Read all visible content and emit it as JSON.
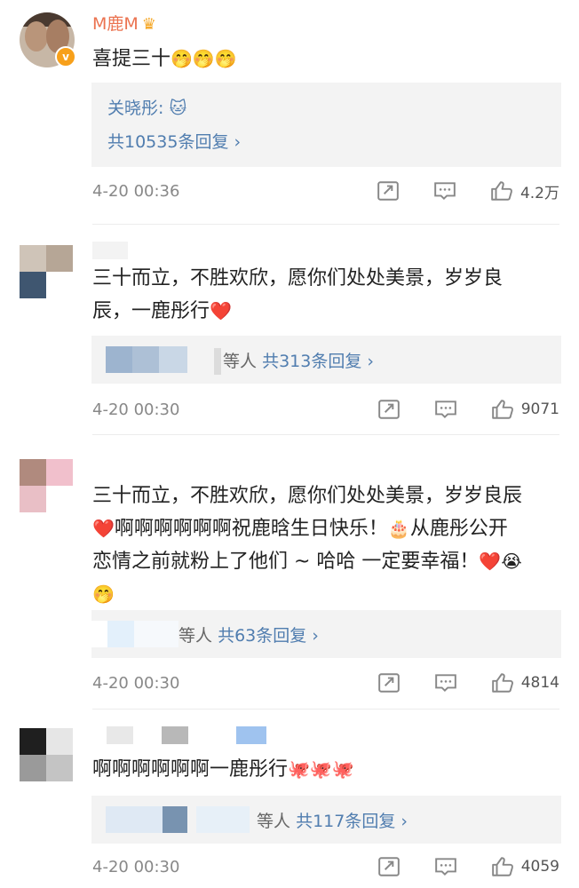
{
  "comments": [
    {
      "username": "M鹿M",
      "text": "喜提三十",
      "emoji": "🤭🤭🤭",
      "reply_preview_name": "关晓彤:",
      "reply_preview_emoji": "🐱",
      "reply_count": "共10535条回复",
      "time": "4-20 00:36",
      "likes": "4.2万"
    },
    {
      "text_line1": "三十而立，不胜欢欣，愿你们处处美景，岁岁良",
      "text_line2": "辰，一鹿彤行",
      "emoji": "❤️",
      "replies_prefix": "等人",
      "reply_count": "共313条回复",
      "time": "4-20 00:30",
      "likes": "9071"
    },
    {
      "text_line1": "三十而立，不胜欢欣，愿你们处处美景，岁岁良辰",
      "text_line2": "啊啊啊啊啊啊祝鹿晗生日快乐！",
      "text_line2_tail": "从鹿彤公开",
      "text_line3": "恋情之前就粉上了他们 ~ 哈哈 一定要幸福！",
      "emoji_heart": "❤️",
      "emoji_cake": "🎂",
      "emoji_cry": "😭",
      "emoji_last": "🤭",
      "replies_prefix": "等人",
      "reply_count": "共63条回复",
      "time": "4-20 00:30",
      "likes": "4814"
    },
    {
      "text": "啊啊啊啊啊啊一鹿彤行",
      "emoji": "🐙🐙🐙",
      "replies_prefix": "等人",
      "reply_count": "共117条回复",
      "time": "4-20 00:30",
      "likes": "4059"
    }
  ],
  "chevron": "›",
  "colors": {
    "link": "#507daf",
    "username": "#eb7350",
    "meta": "#888888",
    "reply_bg": "#f3f3f3"
  }
}
